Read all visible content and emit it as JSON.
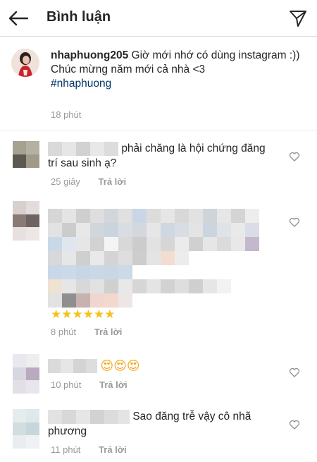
{
  "header": {
    "title": "Bình luận"
  },
  "caption": {
    "username": "nhaphuong205",
    "line1": " Giờ mới nhớ có dùng instagram :))",
    "line2": "Chúc mừng năm mới cả nhà <3",
    "hashtag": "#nhaphuong",
    "time": "18 phút"
  },
  "comments": [
    {
      "text": "phải chăng là hội chứng đăng trí sau sinh ạ?",
      "time": "25 giây",
      "reply": "Trả lời"
    },
    {
      "stars": "★★★★★★",
      "time": "8 phút",
      "reply": "Trả lời"
    },
    {
      "emoji": "😍😍😍",
      "time": "10 phút",
      "reply": "Trả lời"
    },
    {
      "text": "Sao đăng trễ vậy cô nhã phương",
      "time": "11 phút",
      "reply": "Trả lời"
    }
  ],
  "icons": {
    "back": "arrow-left-icon",
    "send": "paper-plane-icon",
    "like": "heart-outline-icon"
  }
}
